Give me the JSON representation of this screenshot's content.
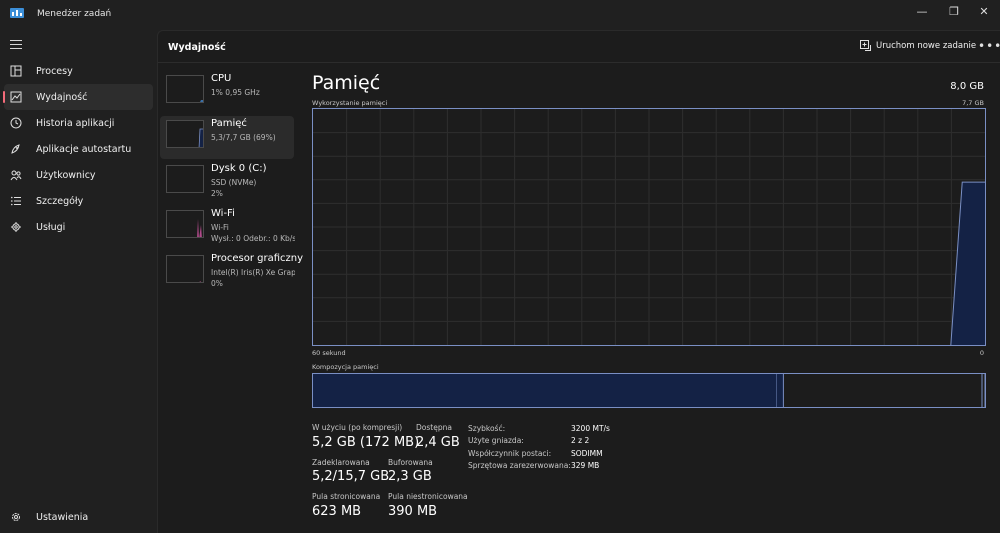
{
  "app": {
    "title": "Menedżer zadań"
  },
  "window_buttons": {
    "minimize": "—",
    "restore": "❐",
    "close": "✕"
  },
  "nav": {
    "items": [
      {
        "label": "Procesy",
        "icon": "processes-icon"
      },
      {
        "label": "Wydajność",
        "icon": "performance-icon",
        "active": true
      },
      {
        "label": "Historia aplikacji",
        "icon": "history-icon"
      },
      {
        "label": "Aplikacje autostartu",
        "icon": "startup-icon"
      },
      {
        "label": "Użytkownicy",
        "icon": "users-icon"
      },
      {
        "label": "Szczegóły",
        "icon": "details-icon"
      },
      {
        "label": "Usługi",
        "icon": "services-icon"
      }
    ],
    "settings_label": "Ustawienia"
  },
  "header": {
    "page_title": "Wydajność",
    "run_task_label": "Uruchom nowe zadanie",
    "more_label": "•••"
  },
  "resources": [
    {
      "name": "CPU",
      "line1": "1% 0,95 GHz",
      "line2": ""
    },
    {
      "name": "Pamięć",
      "line1": "5,3/7,7 GB (69%)",
      "line2": "",
      "active": true
    },
    {
      "name": "Dysk 0 (C:)",
      "line1": "SSD (NVMe)",
      "line2": "2%"
    },
    {
      "name": "Wi-Fi",
      "line1": "Wi-Fi",
      "line2": "Wysł.: 0 Odebr.: 0 Kb/s"
    },
    {
      "name": "Procesor graficzny",
      "line1": "Intel(R) Iris(R) Xe Graph",
      "line2": "0%"
    }
  ],
  "detail": {
    "title": "Pamięć",
    "total": "8,0 GB",
    "usage_label": "Wykorzystanie pamięci",
    "usage_max": "7,7 GB",
    "time_left": "60 sekund",
    "time_right": "0",
    "composition_label": "Kompozycja pamięci",
    "usage_history_fraction_of_max": [
      0,
      0,
      0,
      0,
      0,
      0,
      0,
      0,
      0,
      0,
      0,
      0,
      0,
      0,
      0,
      0,
      0,
      0,
      0,
      0,
      0,
      0,
      0,
      0,
      0,
      0,
      0,
      0,
      0,
      0,
      0,
      0,
      0,
      0,
      0,
      0,
      0,
      0,
      0,
      0,
      0,
      0,
      0,
      0,
      0,
      0,
      0,
      0,
      0,
      0,
      0,
      0,
      0,
      0,
      0,
      0,
      0,
      0.69,
      0.69,
      0.69
    ],
    "composition": {
      "in_use_fraction": 0.69,
      "modified_fraction": 0.01,
      "standby_fraction": 0.3
    },
    "colors": {
      "accent": "#7a8fc4",
      "fill": "#142245",
      "grid": "#2e2e2e"
    }
  },
  "stats": {
    "in_use_label": "W użyciu (po kompresji)",
    "in_use_value": "5,2 GB (172 MB)",
    "available_label": "Dostępna",
    "available_value": "2,4 GB",
    "committed_label": "Zadeklarowana",
    "committed_value": "5,2/15,7 GB",
    "cached_label": "Buforowana",
    "cached_value": "2,3 GB",
    "paged_label": "Pula stronicowana",
    "paged_value": "623 MB",
    "nonpaged_label": "Pula niestronicowana",
    "nonpaged_value": "390 MB"
  },
  "props": [
    {
      "key": "Szybkość:",
      "value": "3200 MT/s"
    },
    {
      "key": "Użyte gniazda:",
      "value": "2 z 2"
    },
    {
      "key": "Współczynnik postaci:",
      "value": "SODIMM"
    },
    {
      "key": "Sprzętowa zarezerwowana:",
      "value": "329 MB"
    }
  ]
}
